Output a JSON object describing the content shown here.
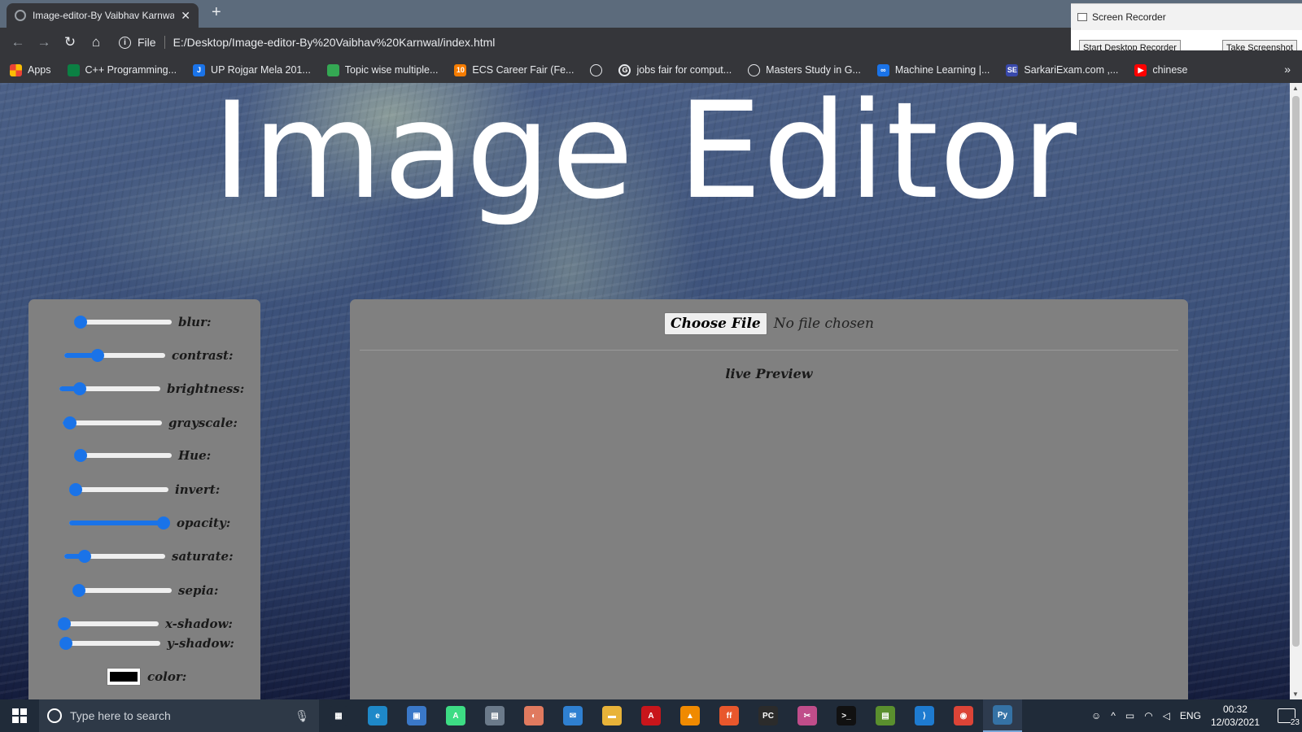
{
  "browser": {
    "tab_title": "Image-editor-By Vaibhav Karnwal",
    "new_tab_symbol": "+",
    "close_symbol": "✕",
    "address_scheme": "File",
    "address_url": "E:/Desktop/Image-editor-By%20Vaibhav%20Karnwal/index.html",
    "nav_symbols": {
      "back": "←",
      "forward": "→",
      "reload": "↻",
      "home": "⌂",
      "info": "i",
      "more": "»"
    }
  },
  "bookmarks": [
    {
      "label": "Apps",
      "icon": "apps-grid-icon",
      "color": "#fbbc04"
    },
    {
      "label": "C++ Programming...",
      "icon": "site-icon",
      "color": "#0b8043"
    },
    {
      "label": "UP Rojgar Mela 201...",
      "icon": "site-icon",
      "color": "#1a73e8",
      "glyph": "J"
    },
    {
      "label": "Topic wise multiple...",
      "icon": "site-icon",
      "color": "#34a853"
    },
    {
      "label": "ECS Career Fair (Fe...",
      "icon": "site-icon",
      "color": "#f57c00",
      "glyph": "10"
    },
    {
      "label": "",
      "icon": "globe-icon",
      "color": "#9aa0a6"
    },
    {
      "label": "jobs fair for comput...",
      "icon": "google-icon",
      "color": "#ffffff",
      "glyph": "G"
    },
    {
      "label": "Masters Study in G...",
      "icon": "globe-icon",
      "color": "#9aa0a6"
    },
    {
      "label": "Machine Learning |...",
      "icon": "infinity-icon",
      "color": "#1a73e8",
      "glyph": "∞"
    },
    {
      "label": "SarkariExam.com ,...",
      "icon": "site-icon",
      "color": "#3949ab",
      "glyph": "SE"
    },
    {
      "label": "chinese",
      "icon": "youtube-icon",
      "color": "#ff0000",
      "glyph": "▶"
    }
  ],
  "screen_recorder": {
    "title": "Screen Recorder",
    "start_button": "Start Desktop Recorder",
    "screenshot_button": "Take Screenshot"
  },
  "page": {
    "title": "Image Editor",
    "controls": [
      {
        "id": "blur",
        "label": "blur:",
        "value": 0
      },
      {
        "id": "contrast",
        "label": "contrast:",
        "value": 0.33
      },
      {
        "id": "brightness",
        "label": "brightness:",
        "value": 0.2
      },
      {
        "id": "grayscale",
        "label": "grayscale:",
        "value": 0.07
      },
      {
        "id": "hue",
        "label": "Hue:",
        "value": 0
      },
      {
        "id": "invert",
        "label": "invert:",
        "value": 0
      },
      {
        "id": "opacity",
        "label": "opacity:",
        "value": 1
      },
      {
        "id": "saturate",
        "label": "saturate:",
        "value": 0.2
      },
      {
        "id": "sepia",
        "label": "sepia:",
        "value": 0
      },
      {
        "id": "x-shadow",
        "label": "x-shadow:",
        "value": 0
      },
      {
        "id": "y-shadow",
        "label": "y-shadow:",
        "value": 0
      }
    ],
    "color_label": "color:",
    "color_value": "#000000",
    "choose_file_label": "Choose File",
    "file_status": "No file chosen",
    "preview_label": "live Preview"
  },
  "taskbar": {
    "search_placeholder": "Type here to search",
    "apps": [
      {
        "name": "task-view-icon",
        "color": "#202b39",
        "glyph": "▦"
      },
      {
        "name": "edge-icon",
        "color": "#1e88c8",
        "glyph": "e"
      },
      {
        "name": "store-icon",
        "color": "#3a78c8",
        "glyph": "▣"
      },
      {
        "name": "android-studio-icon",
        "color": "#3ddc84",
        "glyph": "A"
      },
      {
        "name": "reader-icon",
        "color": "#6b7a8a",
        "glyph": "▤"
      },
      {
        "name": "paint-icon",
        "color": "#e07a5f",
        "glyph": "◐"
      },
      {
        "name": "mail-icon",
        "color": "#2f80d1",
        "glyph": "✉"
      },
      {
        "name": "file-explorer-icon",
        "color": "#e8b339",
        "glyph": "▬"
      },
      {
        "name": "acrobat-icon",
        "color": "#c8151b",
        "glyph": "A"
      },
      {
        "name": "vlc-icon",
        "color": "#f08a00",
        "glyph": "▲"
      },
      {
        "name": "firefox-icon",
        "color": "#e8572c",
        "glyph": "ff"
      },
      {
        "name": "pycharm-icon",
        "color": "#2b2b2b",
        "glyph": "PC"
      },
      {
        "name": "snip-icon",
        "color": "#c04d8a",
        "glyph": "✂"
      },
      {
        "name": "terminal-icon",
        "color": "#111111",
        "glyph": ">_"
      },
      {
        "name": "notepad-icon",
        "color": "#5a8f2e",
        "glyph": "▤"
      },
      {
        "name": "vscode-icon",
        "color": "#1e7bd0",
        "glyph": "⟩"
      },
      {
        "name": "chrome-icon",
        "color": "#dc4437",
        "glyph": "◉"
      },
      {
        "name": "python-icon",
        "color": "#3572a5",
        "glyph": "Py"
      }
    ],
    "language": "ENG",
    "time": "00:32",
    "date": "12/03/2021",
    "notification_count": "23"
  }
}
